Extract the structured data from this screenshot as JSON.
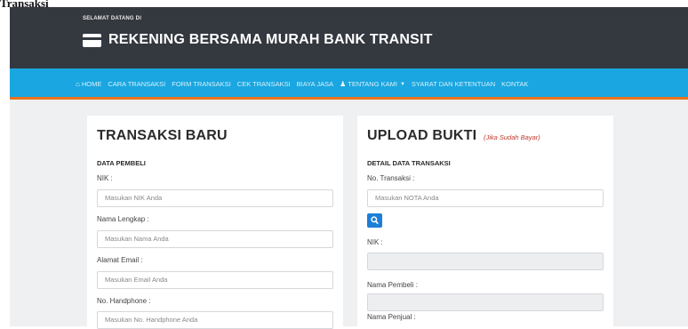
{
  "page": {
    "title": "Transaksi"
  },
  "header": {
    "welcome": "SELAMAT DATANG DI",
    "brand": "REKENING BERSAMA MURAH BANK TRANSIT",
    "brand_icon": "credit-card-icon"
  },
  "nav": {
    "home": "HOME",
    "cara_transaksi": "CARA TRANSAKSI",
    "form_transaksi": "FORM TRANSAKSI",
    "cek_transaksi": "CEK TRANSAKSI",
    "biaya_jasa": "BIAYA JASA",
    "tentang_kami": "TENTANG KAMI",
    "syarat": "SYARAT DAN KETENTUAN",
    "kontak": "KONTAK",
    "home_icon": "home-icon",
    "tentang_icon": "users-icon"
  },
  "colors": {
    "header_bg": "#34383f",
    "nav_bg": "#1aa6e0",
    "nav_accent": "#e8731b",
    "button": "#1c7fd8"
  },
  "left_panel": {
    "title": "TRANSAKSI BARU",
    "section": "DATA PEMBELI",
    "nik_label": "NIK :",
    "nik_placeholder": "Masukan NIK Anda",
    "nama_label": "Nama Lengkap :",
    "nama_placeholder": "Masukan Nama Anda",
    "email_label": "Alamat Email :",
    "email_placeholder": "Masukan Email Anda",
    "hp_label": "No. Handphone :",
    "hp_placeholder": "Masukan No. Handphone Anda"
  },
  "right_panel": {
    "title": "UPLOAD BUKTI",
    "note": "(Jika Sudah Bayar)",
    "section": "DETAIL DATA TRANSAKSI",
    "no_transaksi_label": "No. Transaksi :",
    "no_transaksi_placeholder": "Masukan NOTA Anda",
    "search_icon": "search-icon",
    "nik_label": "NIK :",
    "nik_value": "",
    "nama_pembeli_label": "Nama Pembeli :",
    "nama_pembeli_value": "",
    "nama_penjual_label": "Nama Penjual :"
  }
}
